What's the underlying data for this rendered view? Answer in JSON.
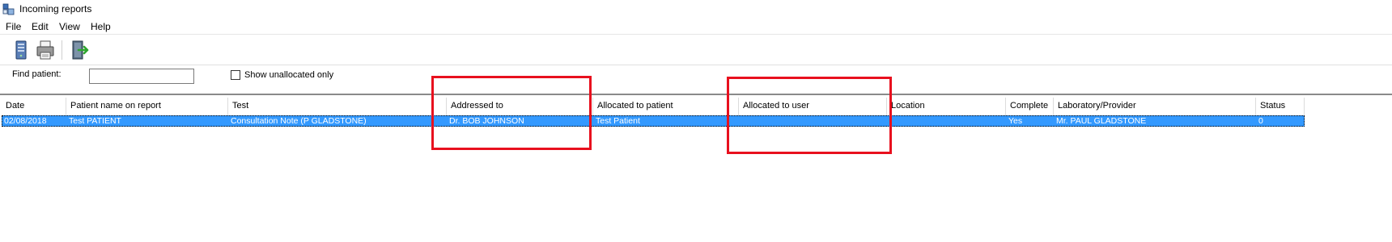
{
  "window": {
    "title": "Incoming reports"
  },
  "menu": {
    "items": [
      "File",
      "Edit",
      "View",
      "Help"
    ]
  },
  "toolbar": {
    "buttons": [
      "computer-tower-icon",
      "printer-icon",
      "exit-door-icon"
    ]
  },
  "filter": {
    "find_label": "Find patient:",
    "find_value": "",
    "checkbox_label": "Show unallocated only",
    "checkbox_checked": false
  },
  "table": {
    "columns": [
      "Date",
      "Patient name on report",
      "Test",
      "Addressed to",
      "Allocated to patient",
      "Allocated to user",
      "Location",
      "Complete",
      "Laboratory/Provider",
      "Status"
    ],
    "rows": [
      [
        "02/08/2018",
        "Test PATIENT",
        "Consultation Note (P GLADSTONE)",
        "Dr. BOB JOHNSON",
        "Test Patient",
        "",
        "",
        "Yes",
        "Mr. PAUL GLADSTONE",
        "0"
      ]
    ],
    "selected_row": 0
  },
  "colors": {
    "selection": "#3399ff",
    "annotation": "#e8101e"
  },
  "annotations": [
    "addressed-to-column",
    "allocated-to-user-column"
  ]
}
